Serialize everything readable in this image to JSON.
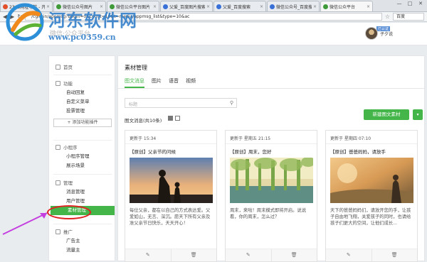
{
  "browser": {
    "tabs": [
      {
        "title": "2345网址导航 - 开",
        "color": "#e2502b",
        "active": false
      },
      {
        "title": "微信公众号图片",
        "color": "#3f9b3a",
        "active": false
      },
      {
        "title": "微信公众平台图片",
        "color": "#3f9b3a",
        "active": false
      },
      {
        "title": "父爱_百度图片搜索",
        "color": "#3870d8",
        "active": false
      },
      {
        "title": "父爱_百度搜索",
        "color": "#3870d8",
        "active": false
      },
      {
        "title": "微信公众号_百度搜",
        "color": "#3870d8",
        "active": false
      },
      {
        "title": "微信公众平台",
        "color": "#3f9b3a",
        "active": true
      }
    ],
    "window_buttons": [
      "—",
      "□",
      "✕"
    ],
    "url": "/cgi-bin/appmsg?begin=0&count=10&t=media/appmsg_list&type=10&ac",
    "search_engine": "百度"
  },
  "watermark": {
    "title": "河东软件网",
    "url": "www.pc0359.cn"
  },
  "header": {
    "logo_text": "微信·公众平台",
    "user_name": "子夕说",
    "user_badge": "已认证"
  },
  "sidebar": {
    "sections": [
      {
        "title": "首页",
        "items": []
      },
      {
        "title": "功能",
        "items": [
          "自动回复",
          "自定义菜单",
          "投票管理"
        ]
      },
      {
        "title": "小程序",
        "items": [
          "小程序管理",
          "展示场景"
        ]
      },
      {
        "title": "管理",
        "items": [
          "消息管理",
          "用户管理",
          "素材管理"
        ]
      },
      {
        "title": "推广",
        "items": [
          "广告主",
          "流量主"
        ]
      }
    ],
    "add_plugin": "+ 添加功能插件",
    "active_item": "素材管理"
  },
  "main": {
    "title": "素材管理",
    "tabs": [
      "图文消息",
      "图片",
      "语音",
      "视频"
    ],
    "active_tab": "图文消息",
    "search_placeholder": "标题",
    "count_label": "图文消息(共10条)",
    "new_button": "新建图文素材",
    "cards": [
      {
        "updated": "更新于 15:34",
        "title": "【原创】父亲节的问候",
        "desc": "每位父亲，都在以自己的方式表达爱。父爱如山，无言、深沉。愿天下所有父亲及准父亲节日快乐，天天开心！"
      },
      {
        "updated": "更新于 星期五 21:15",
        "title": "【原创】周末，您好",
        "desc": "周末，来啦！周末模式即将开启。说说看，你的周末，怎么过？"
      },
      {
        "updated": "更新于 星期四 07:10",
        "title": "【原创】爸爸妈妈，请放手",
        "desc": "天下的爸爸妈妈们，请放开您的手，让孩子自由地飞翔，关爱孩子的同时，也请给孩子们更大的空间，让他们成长..."
      }
    ],
    "card_actions": [
      "edit-icon",
      "delete-icon"
    ]
  },
  "colors": {
    "accent": "#44b549",
    "annotation_red": "#e02222",
    "annotation_purple": "#c43fe0",
    "watermark": "#2878c8"
  }
}
